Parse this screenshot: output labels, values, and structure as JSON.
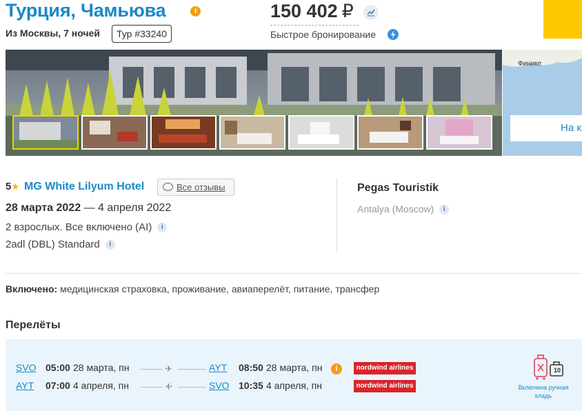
{
  "header": {
    "title": "Турция, Чамьюва",
    "subtitle": "Из Москвы, 7 ночей",
    "tour_id": "Тур #33240",
    "price": "150 402",
    "currency": "₽",
    "fast_booking": "Быстрое бронирование"
  },
  "map": {
    "city_label": "Финике",
    "button_label": "На к"
  },
  "hotel": {
    "stars": "5",
    "name": "MG White Lilyum Hotel",
    "reviews_label": "Все отзывы",
    "date_from": "28 марта 2022",
    "date_sep": " — ",
    "date_to": "4 апреля 2022",
    "guests_meal": "2 взрослых. Все включено (AI)",
    "room": "2adl (DBL) Standard"
  },
  "operator": {
    "name": "Pegas Touristik",
    "route": "Antalya (Moscow)"
  },
  "included": {
    "label": "Включено:",
    "items": "медицинская страховка, проживание, авиаперелёт, питание, трансфер"
  },
  "flights": {
    "title": "Перелёты",
    "rows": [
      {
        "from": "SVO",
        "dep_time": "05:00",
        "dep_date": "28 марта, пн",
        "to": "AYT",
        "arr_time": "08:50",
        "arr_date": "28 марта, пн",
        "airline": "nordwind airlines"
      },
      {
        "from": "AYT",
        "dep_time": "07:00",
        "dep_date": "4 апреля, пн",
        "to": "SVO",
        "arr_time": "10:35",
        "arr_date": "4 апреля, пн",
        "airline": "nordwind airlines"
      }
    ],
    "baggage_count": "10",
    "baggage_label": "Включена ручная кладь"
  },
  "colors": {
    "accent": "#1a89c6",
    "brand_yellow": "#fdc800",
    "airline_red": "#d9242b",
    "flights_bg": "#eaf4fc"
  }
}
